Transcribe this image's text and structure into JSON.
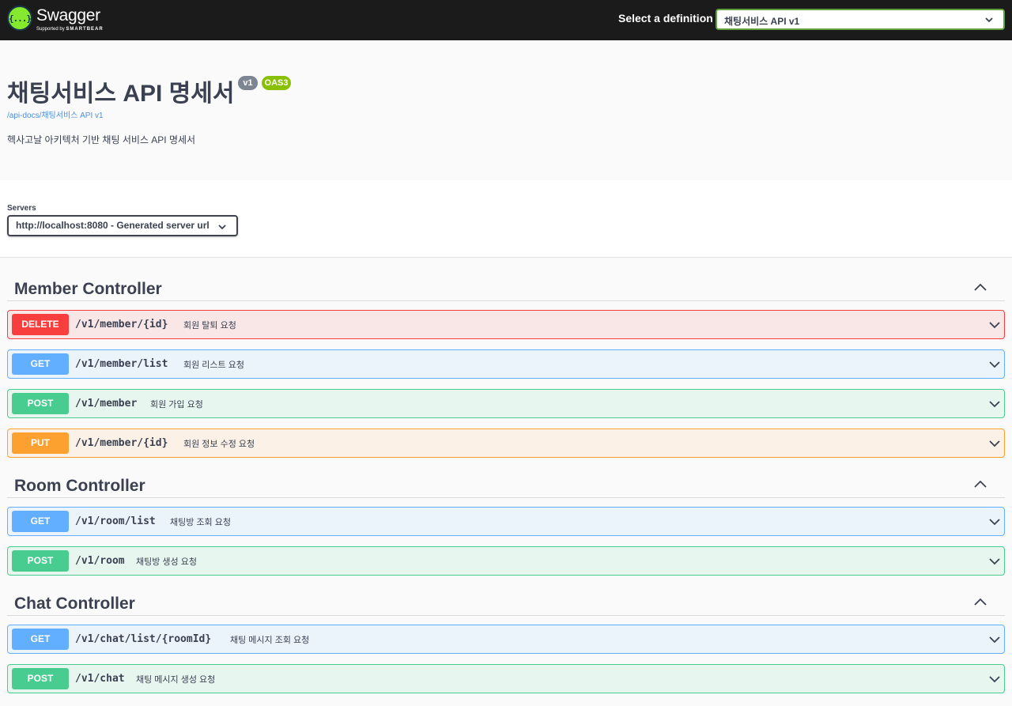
{
  "topbar": {
    "logo_text": "Swagger",
    "logo_mark": "{...}",
    "logo_sub_prefix": "Supported by",
    "logo_sub_brand": "SMARTBEAR",
    "definition_label": "Select a definition",
    "definition_value": "채팅서비스 API v1"
  },
  "info": {
    "title": "채팅서비스 API 명세서",
    "version_badge": "v1",
    "oas_badge": "OAS3",
    "doc_link": "/api-docs/채팅서비스 API v1",
    "description": "헥사고날 아키텍처 기반 채팅 서비스 API 명세서"
  },
  "servers": {
    "label": "Servers",
    "selected": "http://localhost:8080 - Generated server url"
  },
  "tags": [
    {
      "name": "Member Controller",
      "operations": [
        {
          "method": "DELETE",
          "path": "/v1/member/{id}",
          "summary": "회원 탈퇴 요청"
        },
        {
          "method": "GET",
          "path": "/v1/member/list",
          "summary": "회원 리스트 요청"
        },
        {
          "method": "POST",
          "path": "/v1/member",
          "summary": "회원 가입 요청"
        },
        {
          "method": "PUT",
          "path": "/v1/member/{id}",
          "summary": "회원 정보 수정 요청"
        }
      ]
    },
    {
      "name": "Room Controller",
      "operations": [
        {
          "method": "GET",
          "path": "/v1/room/list",
          "summary": "채팅방 조회 요청"
        },
        {
          "method": "POST",
          "path": "/v1/room",
          "summary": "채팅방 생성 요청"
        }
      ]
    },
    {
      "name": "Chat Controller",
      "operations": [
        {
          "method": "GET",
          "path": "/v1/chat/list/{roomId}",
          "summary": "채팅 메시지 조회 요청"
        },
        {
          "method": "POST",
          "path": "/v1/chat",
          "summary": "채팅 메시지 생성 요청"
        }
      ]
    }
  ],
  "colors": {
    "topbar_bg": "#1b1b1b",
    "delete": "#f93e3e",
    "get": "#61affe",
    "post": "#49cc90",
    "put": "#fca130",
    "badge_version": "#7d8492",
    "badge_oas": "#89bf04",
    "link": "#4990e2"
  },
  "icons": {
    "logo": "swagger-logo-icon",
    "definition_dropdown": "chevron-down-icon",
    "server_dropdown": "chevron-down-icon",
    "tag_toggle": "chevron-up-icon",
    "operation_toggle": "chevron-down-icon"
  }
}
